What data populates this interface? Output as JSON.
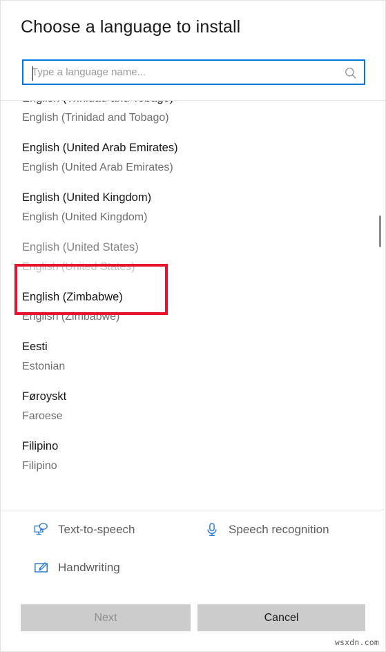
{
  "dialog": {
    "title": "Choose a language to install"
  },
  "search": {
    "placeholder": "Type a language name...",
    "value": "",
    "icon": "search-icon"
  },
  "language_list": {
    "items": [
      {
        "native": "English (Trinidad and Tobago)",
        "english": "English (Trinidad and Tobago)",
        "state": "normal"
      },
      {
        "native": "English (United Arab Emirates)",
        "english": "English (United Arab Emirates)",
        "state": "normal"
      },
      {
        "native": "English (United Kingdom)",
        "english": "English (United Kingdom)",
        "state": "normal"
      },
      {
        "native": "English (United States)",
        "english": "English (United States)",
        "state": "disabled"
      },
      {
        "native": "English (Zimbabwe)",
        "english": "English (Zimbabwe)",
        "state": "normal"
      },
      {
        "native": "Eesti",
        "english": "Estonian",
        "state": "normal"
      },
      {
        "native": "Føroyskt",
        "english": "Faroese",
        "state": "normal"
      },
      {
        "native": "Filipino",
        "english": "Filipino",
        "state": "normal"
      }
    ]
  },
  "annotation": {
    "target": "English (United States)",
    "color": "#e8122a"
  },
  "features": [
    {
      "label": "Text-to-speech",
      "icon": "text-to-speech-icon"
    },
    {
      "label": "Speech recognition",
      "icon": "microphone-icon"
    },
    {
      "label": "Handwriting",
      "icon": "handwriting-pen-icon"
    }
  ],
  "footer": {
    "next_label": "Next",
    "next_enabled": false,
    "cancel_label": "Cancel",
    "cancel_enabled": true
  },
  "watermark": {
    "text": "wsxdn.com"
  },
  "colors": {
    "accent": "#0078d7",
    "annotation": "#e8122a",
    "button_face": "#cccccc"
  }
}
